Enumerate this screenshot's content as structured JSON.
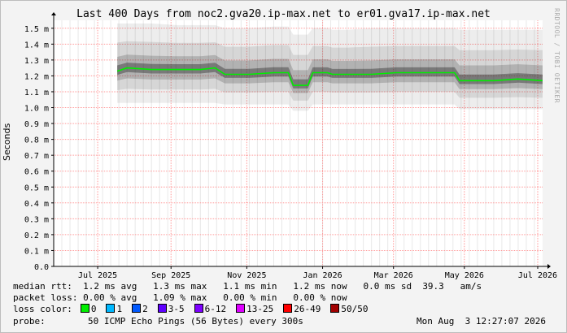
{
  "chart_data": {
    "type": "area",
    "title": "Last 400 Days from noc2.gva20.ip-max.net to er01.gva17.ip-max.net",
    "ylabel": "Seconds",
    "watermark": "RRDTOOL / TOBI OETIKER",
    "ylim": [
      0,
      1.55
    ],
    "yticks": [
      {
        "v": 0,
        "label": "0.0"
      },
      {
        "v": 0.1,
        "label": "0.1 m"
      },
      {
        "v": 0.2,
        "label": "0.2 m"
      },
      {
        "v": 0.3,
        "label": "0.3 m"
      },
      {
        "v": 0.4,
        "label": "0.4 m"
      },
      {
        "v": 0.5,
        "label": "0.5 m"
      },
      {
        "v": 0.6,
        "label": "0.6 m"
      },
      {
        "v": 0.7,
        "label": "0.7 m"
      },
      {
        "v": 0.8,
        "label": "0.8 m"
      },
      {
        "v": 0.9,
        "label": "0.9 m"
      },
      {
        "v": 1.0,
        "label": "1.0 m"
      },
      {
        "v": 1.1,
        "label": "1.1 m"
      },
      {
        "v": 1.2,
        "label": "1.2 m"
      },
      {
        "v": 1.3,
        "label": "1.3 m"
      },
      {
        "v": 1.4,
        "label": "1.4 m"
      },
      {
        "v": 1.5,
        "label": "1.5 m"
      }
    ],
    "xticks": [
      {
        "x": 0.09,
        "label": "Jul 2025"
      },
      {
        "x": 0.24,
        "label": "Sep 2025"
      },
      {
        "x": 0.395,
        "label": "Nov 2025"
      },
      {
        "x": 0.55,
        "label": "Jan 2026"
      },
      {
        "x": 0.695,
        "label": "Mar 2026"
      },
      {
        "x": 0.84,
        "label": "May 2026"
      },
      {
        "x": 0.99,
        "label": "Jul 2026"
      }
    ],
    "series": [
      {
        "name": "median rtt",
        "x": [
          0.13,
          0.15,
          0.2,
          0.25,
          0.3,
          0.33,
          0.35,
          0.4,
          0.45,
          0.48,
          0.49,
          0.52,
          0.53,
          0.55,
          0.56,
          0.57,
          0.6,
          0.65,
          0.7,
          0.75,
          0.8,
          0.82,
          0.83,
          0.85,
          0.9,
          0.95,
          1.0
        ],
        "median": [
          1.23,
          1.25,
          1.24,
          1.24,
          1.24,
          1.25,
          1.21,
          1.21,
          1.22,
          1.22,
          1.14,
          1.14,
          1.22,
          1.22,
          1.22,
          1.21,
          1.21,
          1.21,
          1.22,
          1.22,
          1.22,
          1.22,
          1.17,
          1.17,
          1.17,
          1.18,
          1.17
        ],
        "upper": [
          1.53,
          1.53,
          1.53,
          1.52,
          1.52,
          1.52,
          1.5,
          1.5,
          1.51,
          1.51,
          1.46,
          1.46,
          1.5,
          1.5,
          1.5,
          1.49,
          1.49,
          1.5,
          1.5,
          1.5,
          1.5,
          1.5,
          1.49,
          1.49,
          1.49,
          1.49,
          1.49
        ],
        "lower": [
          1.03,
          1.03,
          1.03,
          1.03,
          1.03,
          1.03,
          1.02,
          1.02,
          1.02,
          1.02,
          0.98,
          0.98,
          1.02,
          1.02,
          1.02,
          1.02,
          1.02,
          1.02,
          1.02,
          1.02,
          1.02,
          1.02,
          0.99,
          0.99,
          0.99,
          0.99,
          0.99
        ],
        "color": "#00ee00"
      }
    ],
    "grid": true,
    "background": "#ffffff",
    "smoke_color": "#333333",
    "grid_color": "#ff9a9a"
  },
  "stats": {
    "line1": "median rtt:  1.2 ms avg   1.3 ms max   1.1 ms min   1.2 ms now   0.0 ms sd  39.3   am/s",
    "line2": "packet loss: 0.00 % avg   1.09 % max   0.00 % min   0.00 % now"
  },
  "loss_legend": {
    "label": "loss color:",
    "items": [
      {
        "label": "0",
        "color": "#00ee00"
      },
      {
        "label": "1",
        "color": "#00b8ff"
      },
      {
        "label": "2",
        "color": "#0059ff"
      },
      {
        "label": "3-5",
        "color": "#5e00ff"
      },
      {
        "label": "6-12",
        "color": "#7e00ff"
      },
      {
        "label": "13-25",
        "color": "#dd00ff"
      },
      {
        "label": "26-49",
        "color": "#ff0000"
      },
      {
        "label": "50/50",
        "color": "#a10000"
      }
    ]
  },
  "probe": {
    "label": "probe:",
    "text": "50 ICMP Echo Pings (56 Bytes) every 300s",
    "timestamp": "Mon Aug  3 12:27:07 2026"
  }
}
